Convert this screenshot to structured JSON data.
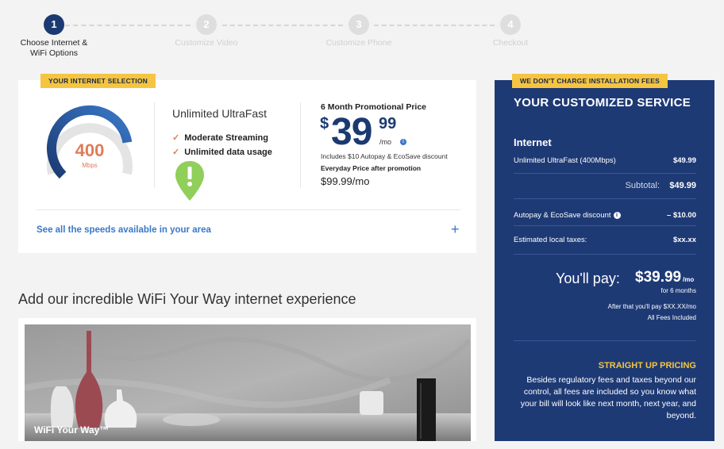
{
  "stepper": {
    "steps": [
      {
        "number": "1",
        "label": "Choose Internet & WiFi Options",
        "state": "active"
      },
      {
        "number": "2",
        "label": "Customize Video",
        "state": "inactive"
      },
      {
        "number": "3",
        "label": "Customize Phone",
        "state": "inactive"
      },
      {
        "number": "4",
        "label": "Checkout",
        "state": "inactive"
      }
    ]
  },
  "selection": {
    "tag": "YOUR INTERNET SELECTION",
    "gauge": {
      "value": "400",
      "unit": "Mbps",
      "level": 0.8
    },
    "plan_name": "Unlimited UltraFast",
    "features": [
      "Moderate Streaming",
      "Unlimited data usage"
    ],
    "promo_label": "6 Month Promotional Price",
    "price": {
      "currency": "$",
      "dollars": "39",
      "cents": "99",
      "per": "/mo"
    },
    "promo_note": "Includes $10 Autopay & EcoSave discount",
    "everyday_label": "Everyday Price after promotion",
    "everyday_price": "$99.99/mo",
    "speeds_link": "See all the speeds available in your area",
    "expand_symbol": "+"
  },
  "wifi": {
    "heading": "Add our incredible WiFi Your Way internet experience",
    "caption": "WiFi Your Way™"
  },
  "summary": {
    "tag": "WE DON'T CHARGE INSTALLATION FEES",
    "title": "YOUR CUSTOMIZED SERVICE",
    "section_head": "Internet",
    "line_item": {
      "label": "Unlimited UltraFast (400Mbps)",
      "value": "$49.99"
    },
    "subtotal_label": "Subtotal:",
    "subtotal_value": "$49.99",
    "discount": {
      "label": "Autopay & EcoSave discount",
      "value": "– $10.00"
    },
    "taxes": {
      "label": "Estimated local taxes:",
      "value": "$xx.xx"
    },
    "pay_label": "You'll pay:",
    "pay_amount": "$39.99",
    "pay_per": "/mo",
    "pay_period": "for 6 months",
    "after_pay": "After that you'll pay $XX.XX/mo",
    "all_fees": "All Fees Included",
    "straight_title": "STRAIGHT UP PRICING",
    "straight_body": "Besides regulatory fees and taxes beyond our control, all fees are included so you know what your bill will look like next month, next year, and beyond."
  },
  "colors": {
    "navy": "#1e3a75",
    "brand_blue": "#1b3a72",
    "link_blue": "#3a78c8",
    "accent_orange": "#e07b5a",
    "tag_yellow": "#f5c542",
    "pin_green": "#8fcf5a"
  },
  "icons": {
    "check": "check-icon",
    "info": "info-icon",
    "pin": "map-pin-icon",
    "plus": "plus-icon"
  }
}
